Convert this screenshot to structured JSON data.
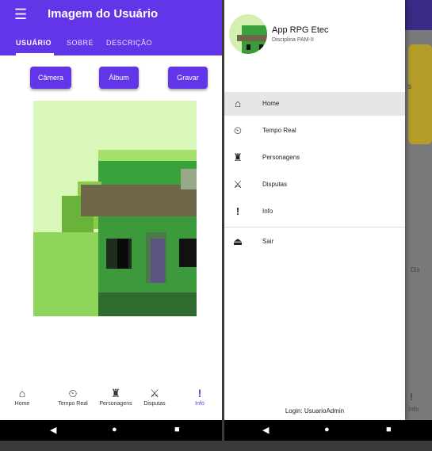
{
  "left": {
    "appbar": {
      "menu_icon": "menu-icon",
      "title": "Imagem do Usuário"
    },
    "tabs": [
      {
        "label": "USUÁRIO",
        "active": true
      },
      {
        "label": "SOBRE",
        "active": false
      },
      {
        "label": "DESCRIÇÃO",
        "active": false
      }
    ],
    "buttons": {
      "camera": "Câmera",
      "album": "Álbum",
      "record": "Gravar"
    },
    "bottom_nav": [
      {
        "icon": "home-icon",
        "label": "Home"
      },
      {
        "icon": "clock-icon",
        "label": "Tempo Real"
      },
      {
        "icon": "figure-icon",
        "label": "Personagens"
      },
      {
        "icon": "fight-icon",
        "label": "Disputas"
      },
      {
        "icon": "info-icon",
        "label": "Info",
        "active": true
      }
    ]
  },
  "drawer": {
    "app_name": "App RPG Etec",
    "subtitle": "Disciplina PAM-II",
    "items": [
      {
        "icon": "home-icon",
        "label": "Home",
        "selected": true
      },
      {
        "icon": "clock-icon",
        "label": "Tempo Real"
      },
      {
        "icon": "figure-icon",
        "label": "Personagens"
      },
      {
        "icon": "fight-icon",
        "label": "Disputas"
      },
      {
        "icon": "info-icon",
        "label": "Info"
      },
      {
        "icon": "logout-icon",
        "label": "Sair"
      }
    ],
    "login": "Login: UsuarioAdmin"
  },
  "background_app": {
    "info_label": "Info",
    "partial_label": "Dis",
    "partial_letter": "s"
  },
  "colors": {
    "primary": "#6236e8",
    "art_green": "#3aa23a",
    "art_light": "#d9f7b8"
  },
  "sysnav": {
    "back": "◀",
    "home": "●",
    "recent": "■"
  }
}
